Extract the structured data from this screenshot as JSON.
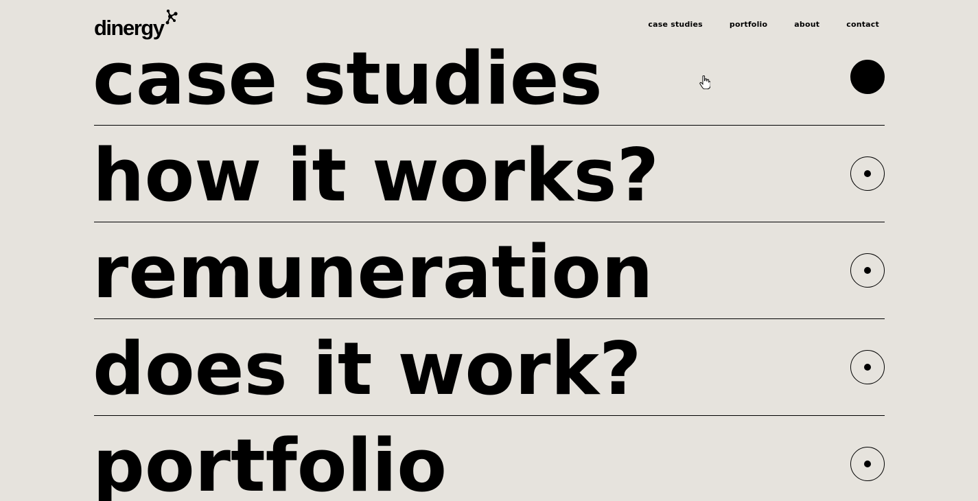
{
  "brand": {
    "name": "dinergy"
  },
  "nav": {
    "items": [
      {
        "label": "case studies"
      },
      {
        "label": "portfolio"
      },
      {
        "label": "about"
      },
      {
        "label": "contact"
      }
    ]
  },
  "sections": [
    {
      "label": "case studies",
      "active": true
    },
    {
      "label": "how it works?",
      "active": false
    },
    {
      "label": "remuneration",
      "active": false
    },
    {
      "label": "does it work?",
      "active": false
    },
    {
      "label": "portfolio",
      "active": false
    }
  ],
  "colors": {
    "background": "#e6e3dd",
    "foreground": "#000000"
  }
}
